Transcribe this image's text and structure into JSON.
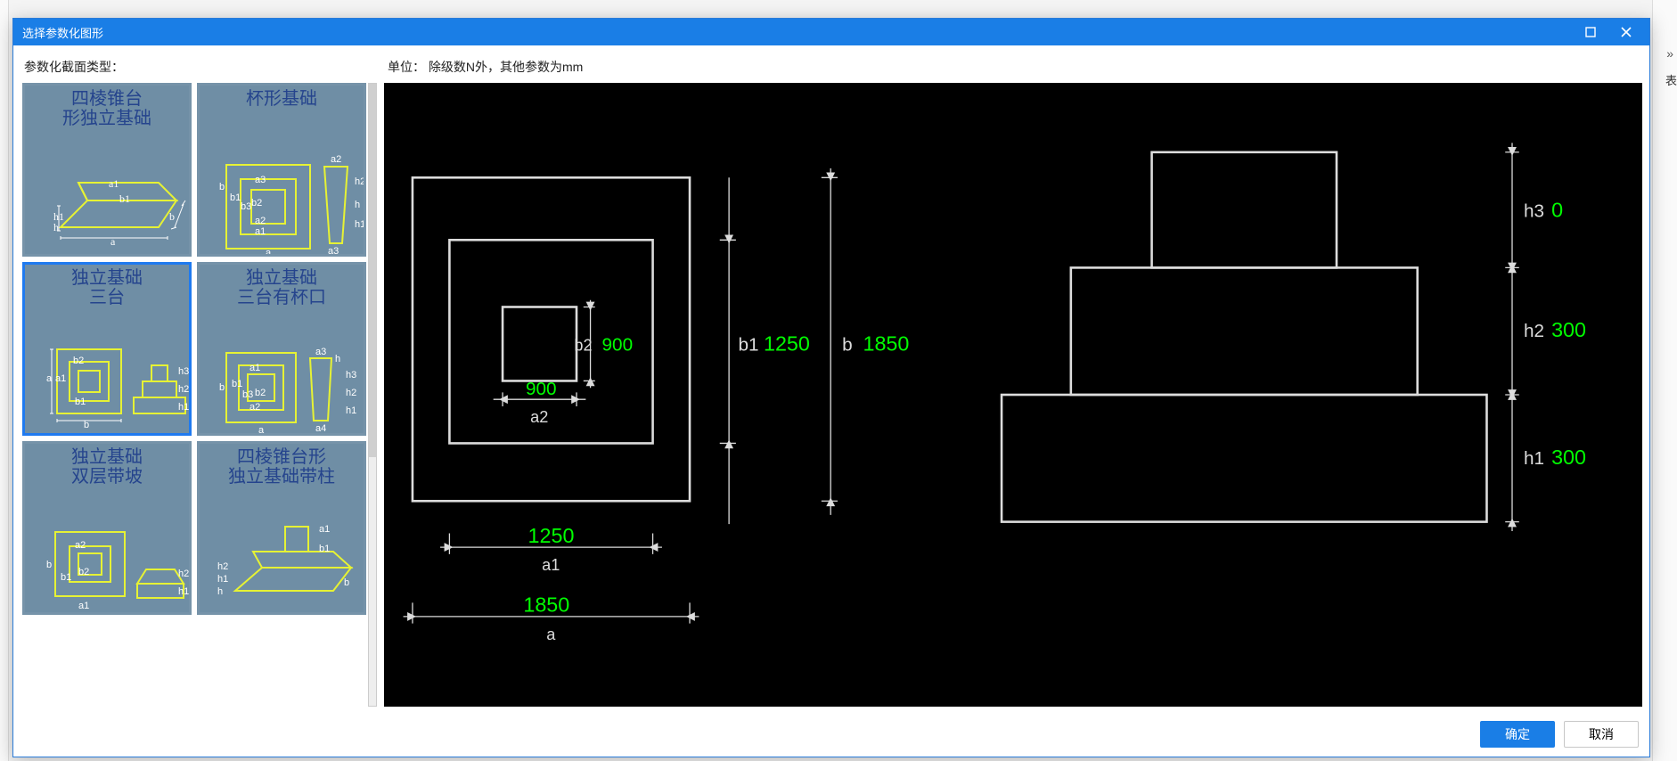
{
  "dialog": {
    "title": "选择参数化图形",
    "leftLabel": "参数化截面类型：",
    "unitLabel": "单位：   除级数N外，其他参数为mm",
    "ok": "确定",
    "cancel": "取消"
  },
  "bg": {
    "rightTab": "表",
    "scrollRight": "»"
  },
  "thumbs": [
    {
      "id": "pyramid-frustum",
      "caption": "四棱锥台\n形独立基础"
    },
    {
      "id": "cup",
      "caption": "杯形基础"
    },
    {
      "id": "triple-step",
      "caption": "独立基础\n三台"
    },
    {
      "id": "triple-step-cup",
      "caption": "独立基础\n三台有杯口"
    },
    {
      "id": "double-slope",
      "caption": "独立基础\n双层带坡"
    },
    {
      "id": "pyramid-column",
      "caption": "四棱锥台形\n独立基础带柱"
    }
  ],
  "selectedThumb": "triple-step",
  "diagram": {
    "a": "1850",
    "a1": "1250",
    "a2": "900",
    "b": "1850",
    "b1": "1250",
    "b2": "900",
    "h1": "300",
    "h2": "300",
    "h3": "0",
    "labels": {
      "a": "a",
      "a1": "a1",
      "a2": "a2",
      "b": "b",
      "b1": "b1",
      "b2": "b2",
      "h1": "h1",
      "h2": "h2",
      "h3": "h3"
    }
  }
}
